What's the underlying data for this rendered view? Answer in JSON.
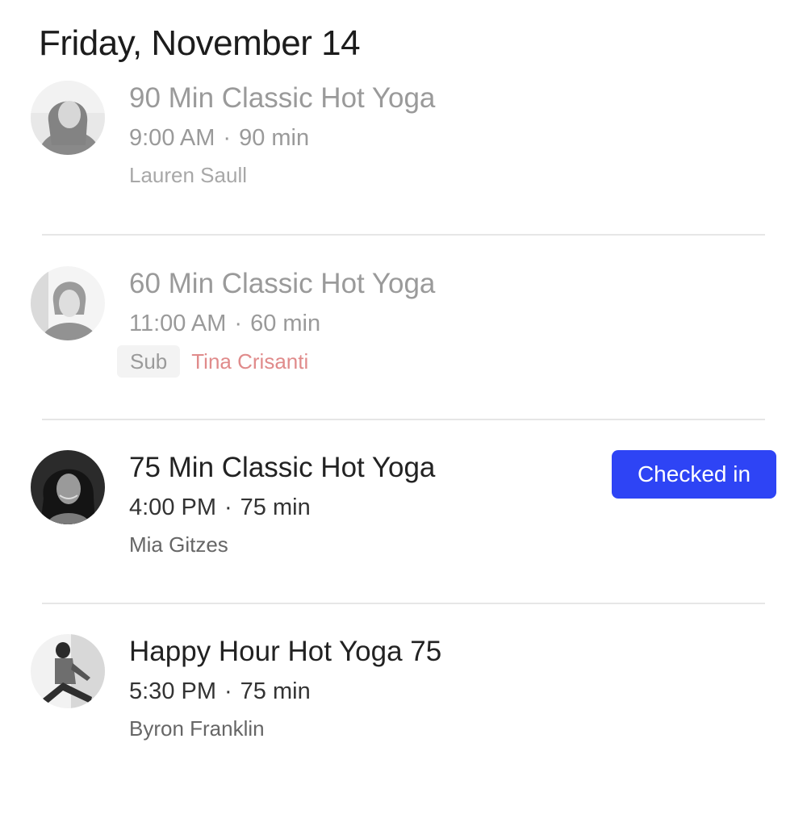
{
  "header": {
    "date": "Friday, November 14"
  },
  "classes": [
    {
      "title": "90 Min Classic Hot Yoga",
      "time": "9:00 AM",
      "separator": "·",
      "duration": "90 min",
      "instructor": "Lauren Saull",
      "state": "past"
    },
    {
      "title": "60 Min Classic Hot Yoga",
      "time": "11:00 AM",
      "separator": "·",
      "duration": "60 min",
      "sub_label": "Sub",
      "instructor": "Tina Crisanti",
      "state": "past"
    },
    {
      "title": "75 Min Classic Hot Yoga",
      "time": "4:00 PM",
      "separator": "·",
      "duration": "75 min",
      "instructor": "Mia Gitzes",
      "status_button": "Checked in",
      "state": "upcoming"
    },
    {
      "title": "Happy Hour Hot Yoga 75",
      "time": "5:30 PM",
      "separator": "·",
      "duration": "75 min",
      "instructor": "Byron Franklin",
      "state": "upcoming"
    }
  ],
  "colors": {
    "accent": "#2e44f5",
    "sub_instructor": "#e08b8b",
    "divider": "#e6e6e6"
  }
}
